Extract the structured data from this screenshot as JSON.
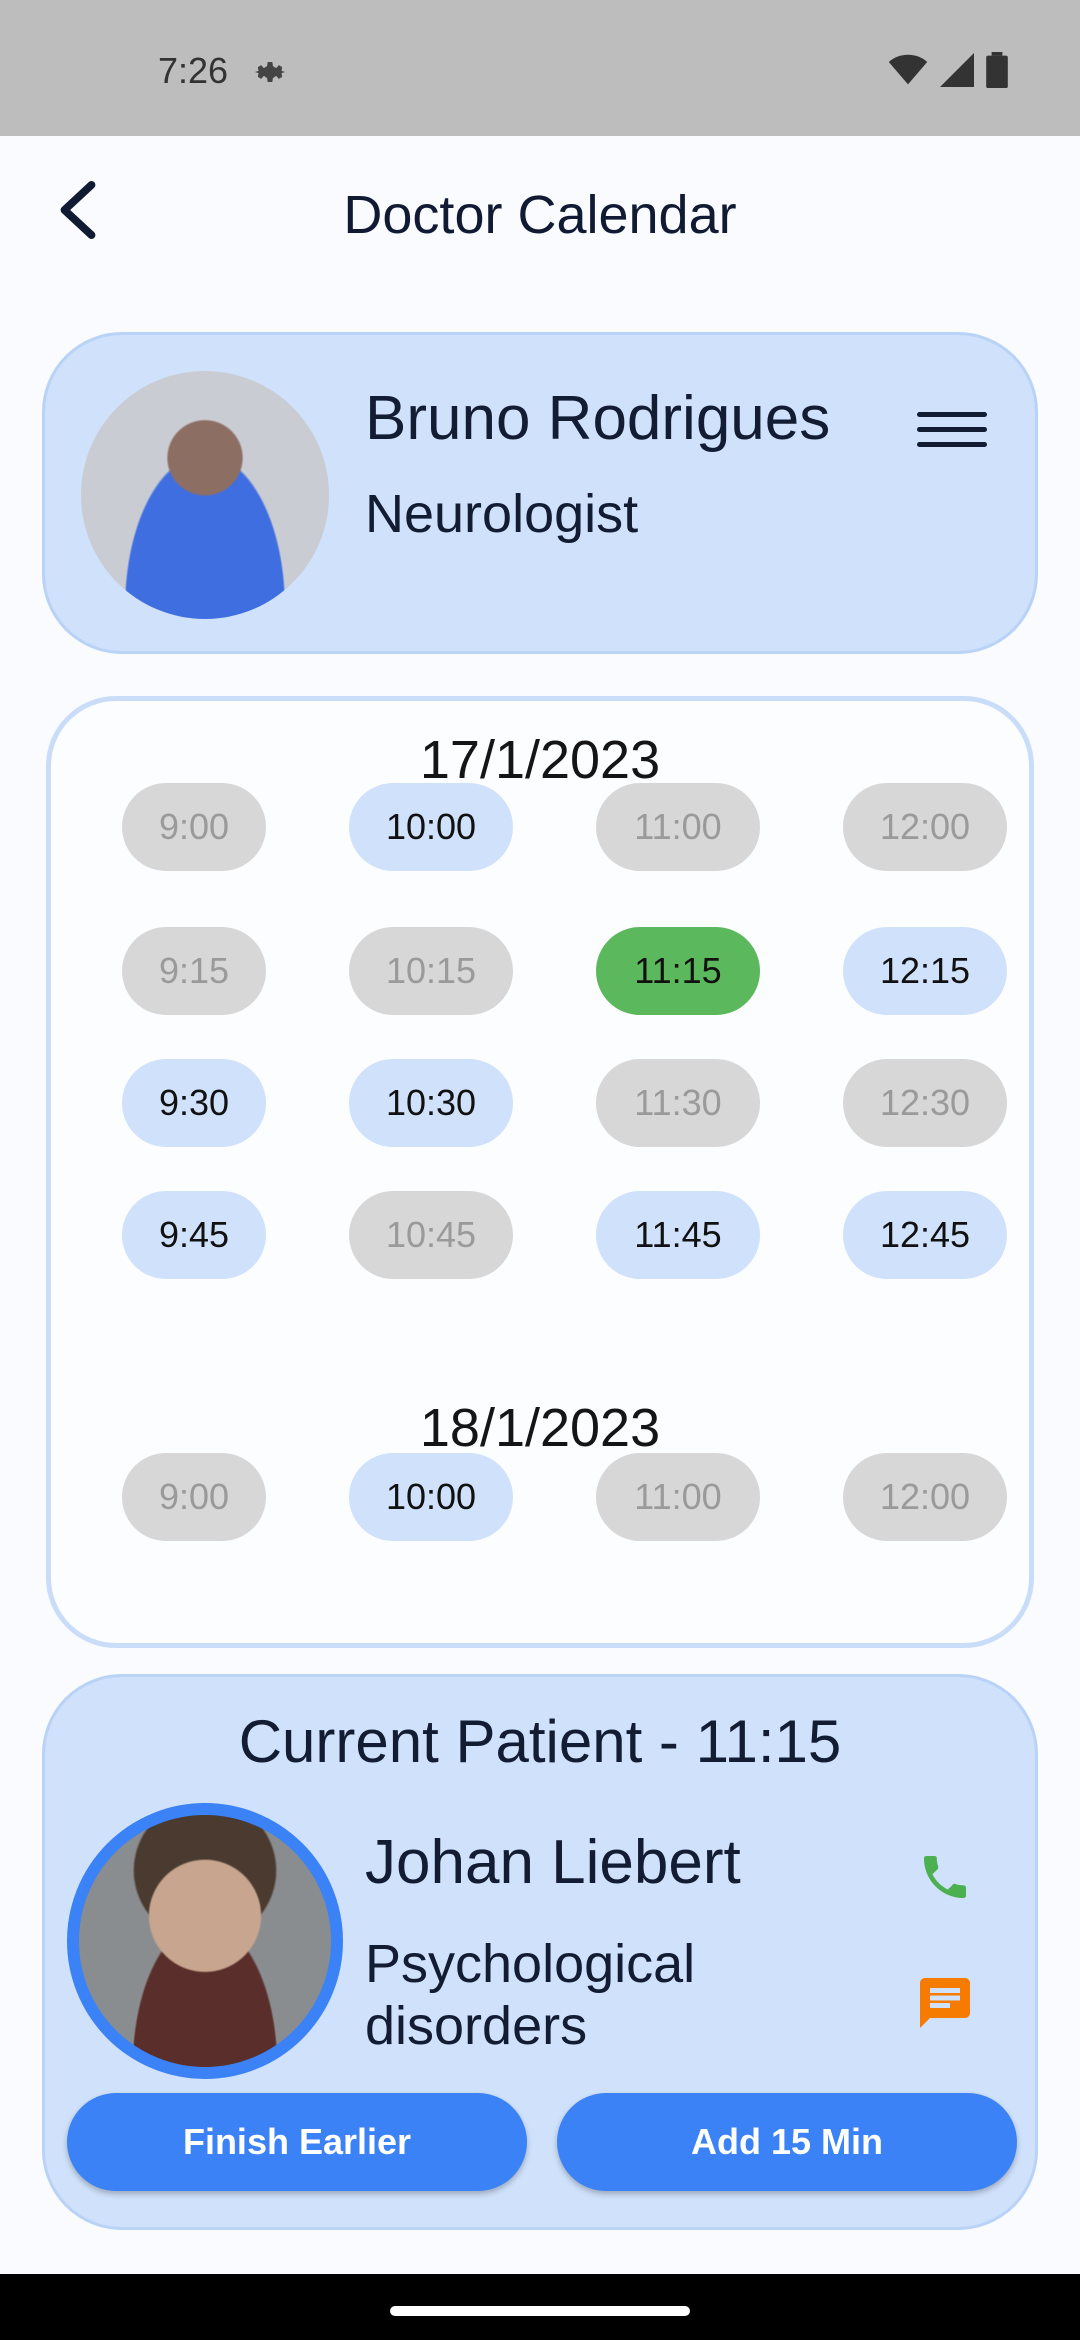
{
  "status_bar": {
    "time": "7:26"
  },
  "app_bar": {
    "title": "Doctor Calendar"
  },
  "doctor": {
    "name": "Bruno Rodrigues",
    "specialty": "Neurologist"
  },
  "calendar": {
    "days": [
      {
        "date": "17/1/2023",
        "slots": [
          {
            "time": "9:00",
            "status": "unavailable"
          },
          {
            "time": "10:00",
            "status": "available"
          },
          {
            "time": "11:00",
            "status": "unavailable"
          },
          {
            "time": "12:00",
            "status": "unavailable"
          },
          {
            "time": "9:15",
            "status": "unavailable"
          },
          {
            "time": "10:15",
            "status": "unavailable"
          },
          {
            "time": "11:15",
            "status": "selected"
          },
          {
            "time": "12:15",
            "status": "available"
          },
          {
            "time": "9:30",
            "status": "available"
          },
          {
            "time": "10:30",
            "status": "available"
          },
          {
            "time": "11:30",
            "status": "unavailable"
          },
          {
            "time": "12:30",
            "status": "unavailable"
          },
          {
            "time": "9:45",
            "status": "available"
          },
          {
            "time": "10:45",
            "status": "unavailable"
          },
          {
            "time": "11:45",
            "status": "available"
          },
          {
            "time": "12:45",
            "status": "available"
          }
        ]
      },
      {
        "date": "18/1/2023",
        "slots": [
          {
            "time": "9:00",
            "status": "unavailable"
          },
          {
            "time": "10:00",
            "status": "available"
          },
          {
            "time": "11:00",
            "status": "unavailable"
          },
          {
            "time": "12:00",
            "status": "unavailable"
          }
        ]
      }
    ]
  },
  "patient": {
    "heading": "Current Patient - 11:15",
    "name": "Johan Liebert",
    "condition": "Psychological disorders",
    "finish_label": "Finish Earlier",
    "add_label": "Add 15 Min"
  },
  "colors": {
    "accent": "#3b82f6",
    "card": "#cfe1fb",
    "selected_slot": "#5cb85c",
    "unavailable_slot": "#d7d7d7",
    "phone_icon": "#4caf50",
    "chat_icon": "#f57c00"
  },
  "icons": {
    "back": "back-arrow-icon",
    "menu": "hamburger-menu-icon",
    "phone": "phone-icon",
    "chat": "chat-icon",
    "settings": "gear-icon"
  }
}
